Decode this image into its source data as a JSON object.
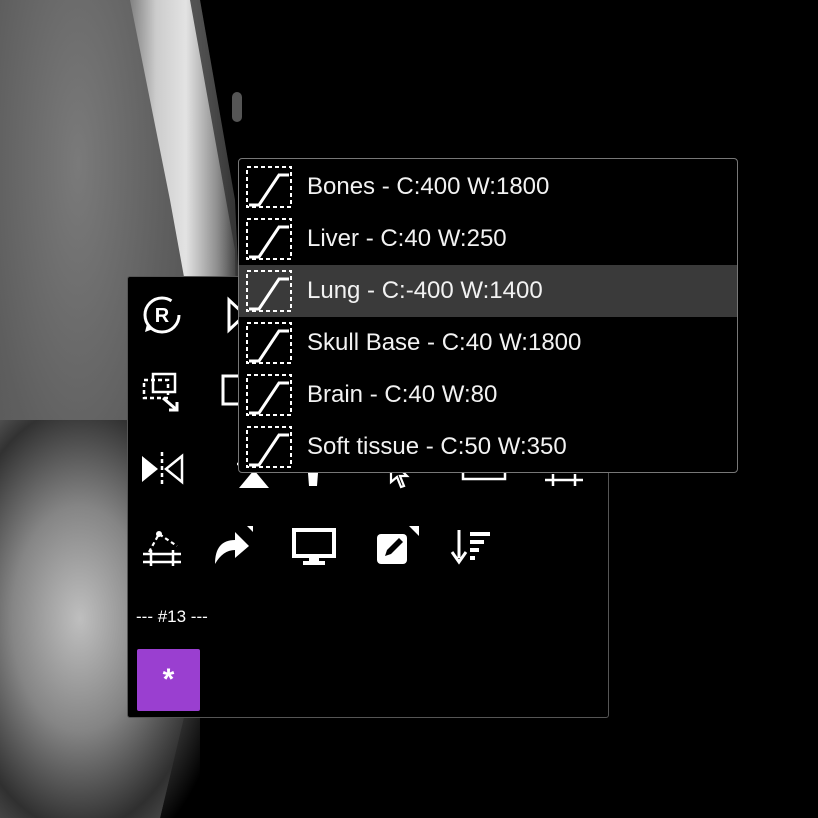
{
  "presets": {
    "items": [
      {
        "label": "Bones - C:400 W:1800",
        "selected": false
      },
      {
        "label": "Liver - C:40 W:250",
        "selected": false
      },
      {
        "label": "Lung - C:-400 W:1400",
        "selected": true
      },
      {
        "label": "Skull Base - C:40 W:1800",
        "selected": false
      },
      {
        "label": "Brain - C:40 W:80",
        "selected": false
      },
      {
        "label": "Soft tissue - C:50 W:350",
        "selected": false
      }
    ]
  },
  "toolbar": {
    "series_label": "--- #13 ---",
    "star_label": "*",
    "tools": [
      {
        "name": "reset-icon"
      },
      {
        "name": "flip-horizontal-icon"
      },
      {
        "name": "capture-region-icon"
      },
      {
        "name": "window-level-icon"
      },
      {
        "name": "mirror-icon"
      },
      {
        "name": "crosshair-icon"
      },
      {
        "name": "pointer-icon"
      },
      {
        "name": "ruler-icon"
      },
      {
        "name": "caliper-icon"
      },
      {
        "name": "angle-measure-icon"
      },
      {
        "name": "redo-icon"
      },
      {
        "name": "display-icon"
      },
      {
        "name": "annotate-icon"
      },
      {
        "name": "sort-icon"
      }
    ]
  },
  "colors": {
    "accent": "#9a3fd0",
    "selected_row": "#3a3a3a",
    "border": "#777777"
  }
}
